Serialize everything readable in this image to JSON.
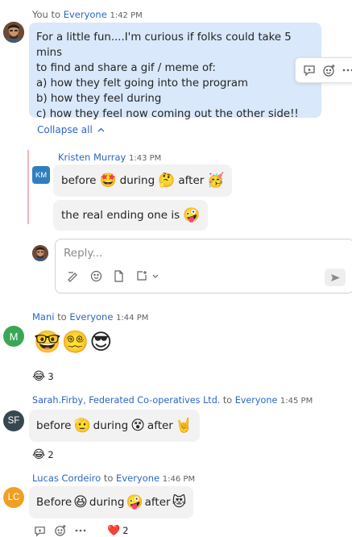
{
  "msg1": {
    "sender": "You",
    "to_word": "to",
    "channel": "Everyone",
    "time": "1:42 PM",
    "lines": [
      "For a little fun....I'm curious if folks could take 5 mins",
      "to find and share a gif / meme of:",
      "a) how they felt going into the program",
      "b) how they feel during",
      "c) how they feel now coming out the other side!!"
    ]
  },
  "thread": {
    "collapse_label": "Collapse all",
    "reply_sender": "Kristen Murray",
    "reply_time": "1:43 PM",
    "reply_initials": "KM",
    "reply1": {
      "w1": "before",
      "w2": "during",
      "w3": "after"
    },
    "reply2": {
      "text": "the real ending one is"
    },
    "reply_placeholder": "Reply..."
  },
  "msg2": {
    "sender": "Mani",
    "to_word": "to",
    "channel": "Everyone",
    "time": "1:44 PM",
    "initial": "M",
    "reaction_count": "3"
  },
  "msg3": {
    "sender": "Sarah.Firby, Federated Co-operatives Ltd.",
    "to_word": "to",
    "channel": "Everyone",
    "time": "1:45 PM",
    "initials": "SF",
    "w1": "before",
    "w2": "during",
    "w3": "after",
    "reaction_count": "2"
  },
  "msg4": {
    "sender": "Lucas Cordeiro",
    "to_word": "to",
    "channel": "Everyone",
    "time": "1:46 PM",
    "initials": "LC",
    "w1": "Before",
    "w2": "during",
    "w3": "after",
    "reaction_count": "2"
  },
  "colors": {
    "accent": "#2b66c4",
    "bubble_self": "#d9e8fa",
    "bubble_other": "#f2f2f2",
    "avatar_km": "#2f7fbf",
    "avatar_m": "#3aa757",
    "avatar_sf": "#37474f",
    "avatar_lc": "#f0a020"
  }
}
